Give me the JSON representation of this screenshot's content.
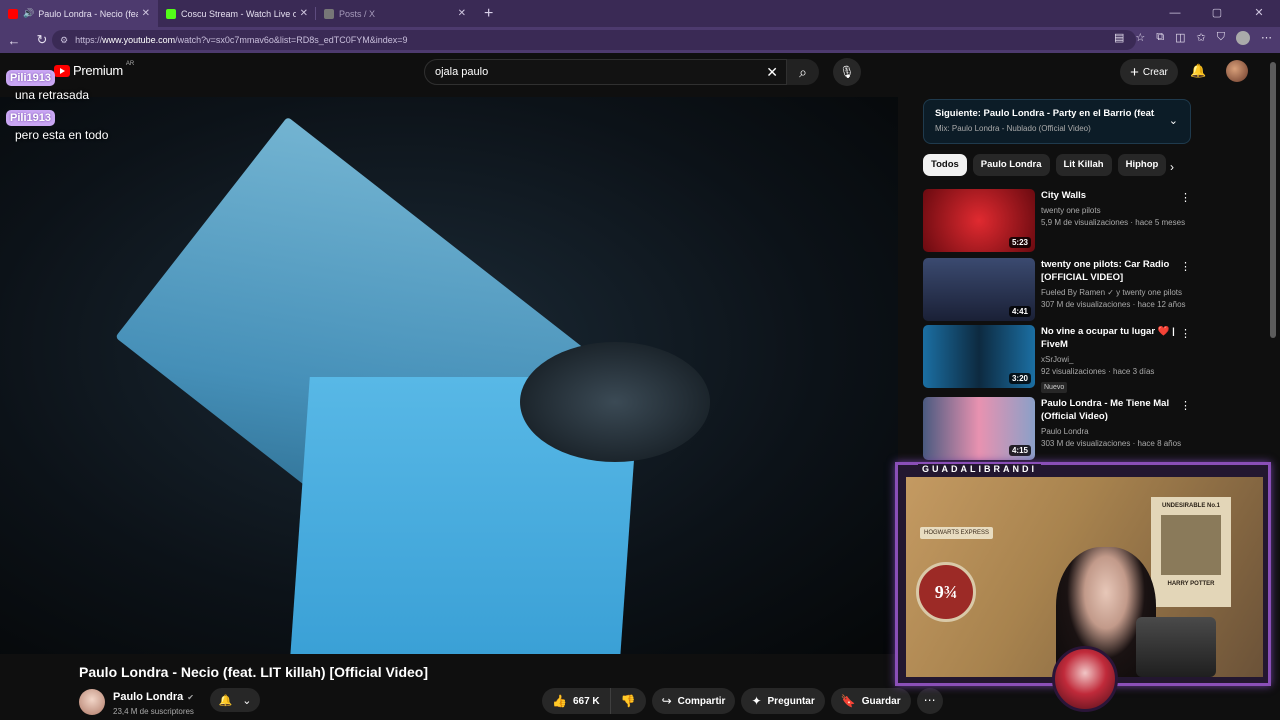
{
  "browser": {
    "tabs": [
      {
        "title": "Paulo Londra - Necio (feat. LIT",
        "favicon_color": "#ff0000",
        "active": true,
        "audio": true
      },
      {
        "title": "Coscu Stream - Watch Live on Kick",
        "favicon_color": "#53fc18",
        "active": false
      },
      {
        "title": "Posts / X",
        "favicon_color": "#777777",
        "active": false
      }
    ],
    "url_prefix": "https://",
    "url_host": "www.youtube.com",
    "url_path": "/watch?v=sx0c7mmav6o&list=RD8s_edTC0FYM&index=9"
  },
  "youtube": {
    "logo_text": "Premium",
    "region": "AR",
    "search_value": "ojala paulo",
    "create_label": "Crear"
  },
  "chat": [
    {
      "user": "Pili1913",
      "message": "una retrasada"
    },
    {
      "user": "Pili1913",
      "message": "pero esta en todo"
    }
  ],
  "video": {
    "title": "Paulo Londra - Necio (feat. LIT killah) [Official Video]",
    "channel": "Paulo Londra",
    "subscribers": "23,4 M de suscriptores",
    "likes": "667 K",
    "share_label": "Compartir",
    "ask_label": "Preguntar",
    "save_label": "Guardar"
  },
  "up_next": {
    "title": "Siguiente: Paulo Londra - Party en el Barrio (feat. D...",
    "subtitle": "Mix: Paulo Londra - Nublado (Official Video)"
  },
  "chips": [
    "Todos",
    "Paulo Londra",
    "Lit Killah",
    "Hiphop"
  ],
  "recommended": [
    {
      "title": "City Walls",
      "channel": "twenty one pilots",
      "meta": "5,9 M de visualizaciones · hace 5 meses",
      "duration": "5:23",
      "thumb_color": "#b3141c",
      "badge": ""
    },
    {
      "title": "twenty one pilots: Car Radio [OFFICIAL VIDEO]",
      "channel": "Fueled By Ramen ✓ y twenty one pilots",
      "meta": "307 M de visualizaciones · hace 12 años",
      "duration": "4:41",
      "thumb_color": "#2a3550",
      "badge": ""
    },
    {
      "title": "No vine a ocupar tu lugar ❤️ | FiveM",
      "channel": "xSrJowi_",
      "meta": "92 visualizaciones · hace 3 días",
      "duration": "3:20",
      "thumb_color": "#1b6fa3",
      "badge": "Nuevo"
    },
    {
      "title": "Paulo Londra - Me Tiene Mal (Official Video)",
      "channel": "Paulo Londra",
      "meta": "303 M de visualizaciones · hace 8 años",
      "duration": "4:15",
      "thumb_color": "#6a7fa5",
      "badge": ""
    }
  ],
  "webcam": {
    "label": "GUADALIBRANDI",
    "sign": "9¾",
    "hogwarts_sign": "HOGWARTS EXPRESS",
    "poster_title": "UNDESIRABLE No.1",
    "poster_name": "HARRY POTTER"
  }
}
